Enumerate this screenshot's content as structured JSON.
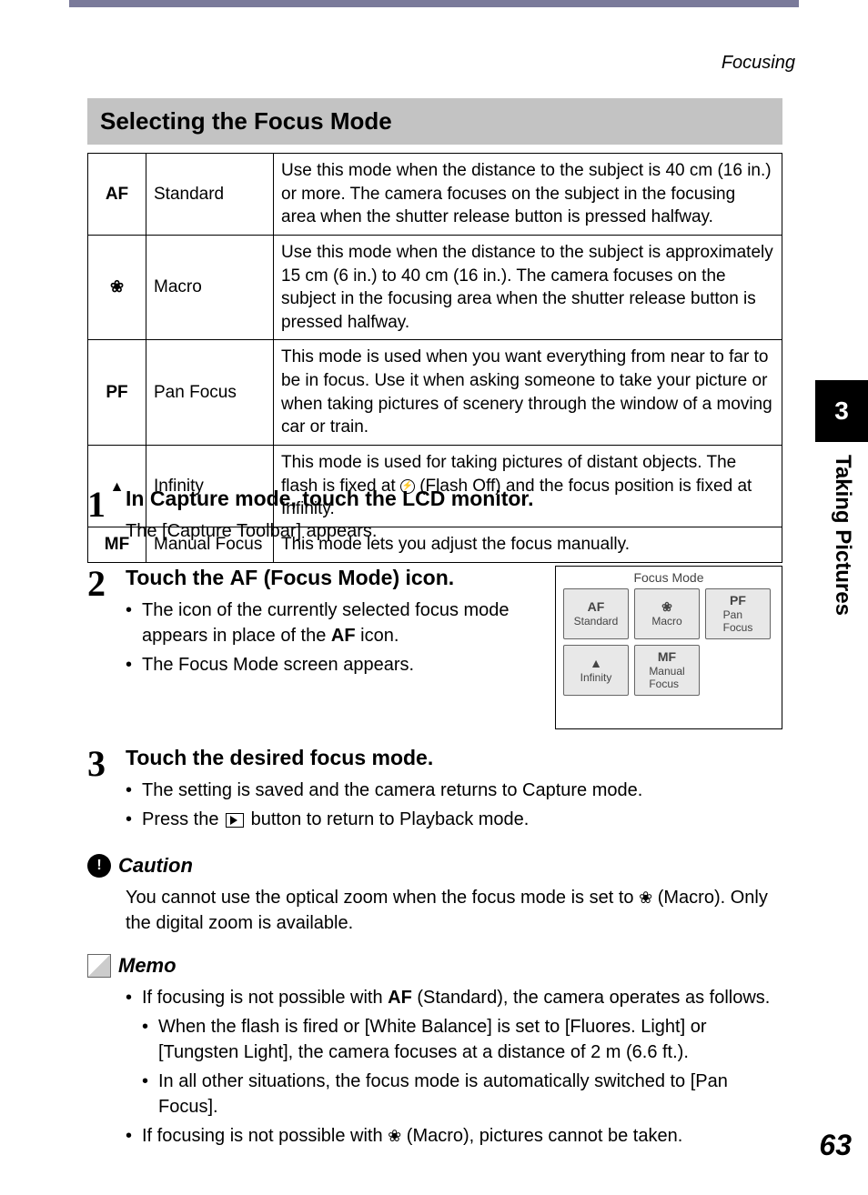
{
  "header": {
    "section": "Focusing"
  },
  "section_title": "Selecting the Focus Mode",
  "table": {
    "rows": [
      {
        "icon": "AF",
        "name": "Standard",
        "desc": "Use this mode when the distance to the subject is 40 cm (16 in.) or more. The camera focuses on the subject in the focusing area when the shutter release button is pressed halfway."
      },
      {
        "icon": "❀",
        "name": "Macro",
        "desc": "Use this mode when the distance to the subject is approximately 15 cm (6 in.) to 40 cm (16 in.). The camera focuses on the subject in the focusing area when the shutter release button is pressed halfway."
      },
      {
        "icon": "PF",
        "name": "Pan Focus",
        "desc": "This mode is used when you want everything from near to far to be in focus. Use it when asking someone to take your picture or when taking pictures of scenery through the window of a moving car or train."
      },
      {
        "icon": "▲",
        "name": "Infinity",
        "desc_pre": "This mode is used for taking pictures of distant objects. The flash is fixed at ",
        "desc_post": " (Flash Off) and the focus position is fixed at Infinity."
      },
      {
        "icon": "MF",
        "name": "Manual Focus",
        "desc": "This mode lets you adjust the focus manually."
      }
    ]
  },
  "steps": {
    "s1": {
      "num": "1",
      "head": "In Capture mode, touch the LCD monitor.",
      "sub": "The [Capture Toolbar] appears."
    },
    "s2": {
      "num": "2",
      "head_pre": "Touch the ",
      "head_af": "AF",
      "head_post": " (Focus Mode) icon.",
      "b1_pre": "The icon of the currently selected focus mode appears in place of the ",
      "b1_af": "AF",
      "b1_post": " icon.",
      "b2": "The Focus Mode screen appears."
    },
    "s3": {
      "num": "3",
      "head": "Touch the desired focus mode.",
      "b1": "The setting is saved and the camera returns to Capture mode.",
      "b2_pre": "Press the ",
      "b2_post": " button to return to Playback mode."
    }
  },
  "lcd": {
    "title": "Focus Mode",
    "btns": [
      {
        "top": "AF",
        "bottom": "Standard"
      },
      {
        "top": "❀",
        "bottom": "Macro"
      },
      {
        "top": "PF",
        "bottom": "Pan\nFocus"
      },
      {
        "top": "▲",
        "bottom": "Infinity"
      },
      {
        "top": "MF",
        "bottom": "Manual\nFocus"
      }
    ]
  },
  "caution": {
    "title": "Caution",
    "body_pre": "You cannot use the optical zoom when the focus mode is set to ",
    "body_post": " (Macro). Only the digital zoom is available."
  },
  "memo": {
    "title": "Memo",
    "b1_pre": "If focusing is not possible with ",
    "b1_af": "AF",
    "b1_post": " (Standard), the camera operates as follows.",
    "sb1": "When the flash is fired or [White Balance] is set to [Fluores. Light] or [Tungsten Light], the camera focuses at a distance of 2 m (6.6 ft.).",
    "sb2": "In all other situations, the focus mode is automatically switched to [Pan Focus].",
    "b2_pre": "If focusing is not possible with ",
    "b2_post": " (Macro), pictures cannot be taken."
  },
  "side": {
    "chapter": "3",
    "title": "Taking Pictures"
  },
  "page": "63"
}
